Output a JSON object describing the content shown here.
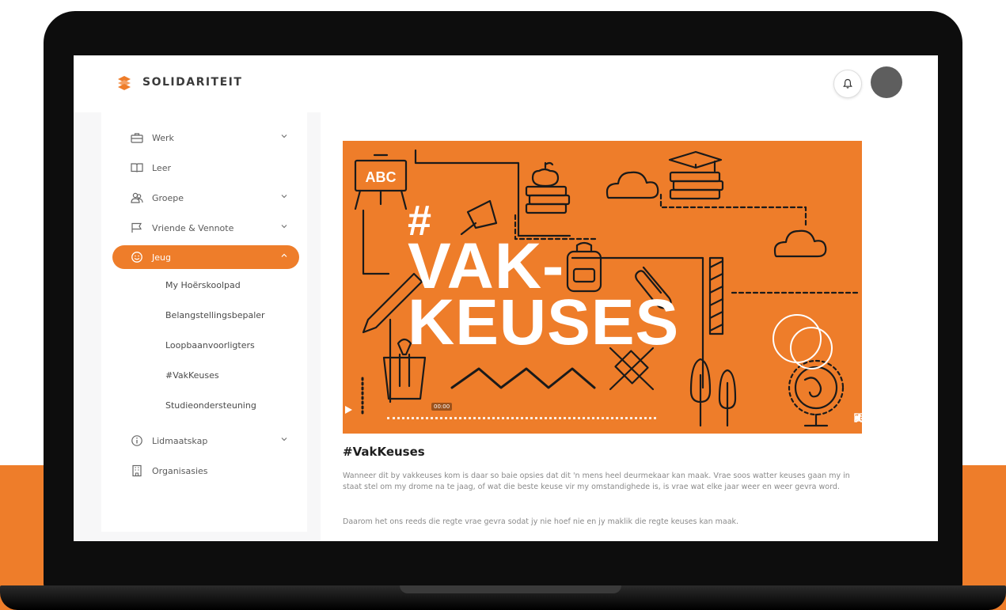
{
  "colors": {
    "brand": "#ee7d2a",
    "text": "#5a5a5a"
  },
  "header": {
    "logo_text": "SOLIDARITEIT",
    "bell_icon": "bell-icon"
  },
  "sidebar": {
    "items": [
      {
        "label": "Werk",
        "icon": "briefcase-icon",
        "chevron": true
      },
      {
        "label": "Leer",
        "icon": "book-icon",
        "chevron": false
      },
      {
        "label": "Groepe",
        "icon": "users-icon",
        "chevron": true
      },
      {
        "label": "Vriende & Vennote",
        "icon": "flag-icon",
        "chevron": true
      },
      {
        "label": "Jeug",
        "icon": "smiley-icon",
        "chevron": true,
        "active": true
      },
      {
        "label": "Lidmaatskap",
        "icon": "info-icon",
        "chevron": true
      },
      {
        "label": "Organisasies",
        "icon": "building-icon",
        "chevron": false
      }
    ],
    "sub_items": [
      "My Hoërskoolpad",
      "Belangstellingsbepaler",
      "Loopbaanvoorligters",
      "#VakKeuses",
      "Studieondersteuning"
    ]
  },
  "video": {
    "hero_hash": "#",
    "hero_line1": "VAK-",
    "hero_line2": "KEUSES",
    "board_text": "ABC",
    "time": "00:00"
  },
  "main": {
    "title": "#VakKeuses",
    "paragraph1": "Wanneer dit by vakkeuses kom is daar so baie opsies dat dit 'n mens heel deurmekaar kan maak. Vrae soos watter keuses gaan my in staat stel om my drome na te jaag, of wat die beste keuse vir my omstandighede is, is vrae wat elke jaar weer en weer gevra word.",
    "paragraph2": "Daarom het ons reeds die regte vrae gevra sodat jy nie hoef nie en jy maklik die regte keuses kan maak."
  }
}
